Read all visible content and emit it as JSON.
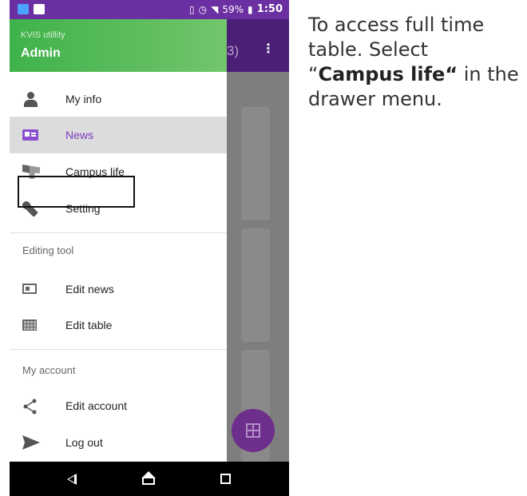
{
  "status_bar": {
    "battery": "59%",
    "time": "1:50"
  },
  "app_bar": {
    "title_fragment": "3)",
    "overflow": "⋮"
  },
  "drawer": {
    "header": {
      "app_name": "KVIS utillity",
      "user_name": "Admin"
    },
    "items": [
      {
        "label": "My info",
        "icon": "person-icon"
      },
      {
        "label": "News",
        "icon": "news-icon",
        "active": true
      },
      {
        "label": "Campus life",
        "icon": "campus-icon"
      },
      {
        "label": "Setting",
        "icon": "wrench-icon"
      }
    ],
    "editing_section": {
      "title": "Editing tool",
      "items": [
        {
          "label": "Edit news",
          "icon": "edit-news-icon"
        },
        {
          "label": "Edit table",
          "icon": "table-icon"
        }
      ]
    },
    "account_section": {
      "title": "My account",
      "items": [
        {
          "label": "Edit account",
          "icon": "share-icon"
        },
        {
          "label": "Log out",
          "icon": "send-icon"
        }
      ]
    }
  },
  "instruction": {
    "part1": "To access full time table. Select “",
    "bold": "Campus life“",
    "part2": " in the drawer menu."
  },
  "colors": {
    "status_bar": "#6a2fa0",
    "drawer_header": "#3fb24b",
    "active_text": "#7b3cc0",
    "fab": "#6e2f8c"
  }
}
